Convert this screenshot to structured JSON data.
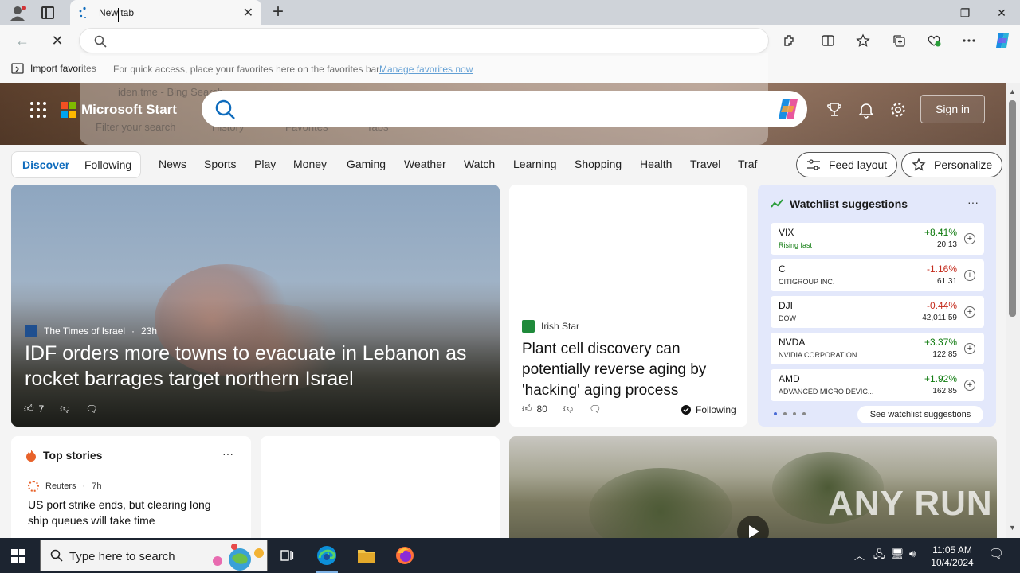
{
  "browser": {
    "tab_title": "New tab",
    "address_value": "",
    "suggestions": {
      "item1": "iden.tme",
      "item1_suffix": "- Bing Search",
      "filter_placeholder": "Filter your search",
      "filter_history": "History",
      "filter_favorites": "Favorites",
      "filter_tabs": "Tabs"
    }
  },
  "favbar": {
    "import_label": "Import favorites",
    "message": "For quick access, place your favorites here on the favorites bar.",
    "manage_link": "Manage favorites now"
  },
  "msstart": {
    "brand": "Microsoft Start",
    "signin": "Sign in",
    "pills": [
      "Discover",
      "Following"
    ],
    "categories": [
      "News",
      "Sports",
      "Play",
      "Money",
      "Gaming",
      "Weather",
      "Watch",
      "Learning",
      "Shopping",
      "Health",
      "Travel",
      "Traf"
    ],
    "feed_layout": "Feed layout",
    "personalize": "Personalize"
  },
  "main_story": {
    "source": "The Times of Israel",
    "age": "23h",
    "title": "IDF orders more towns to evacuate in Lebanon as rocket barrages target northern Israel",
    "likes": "7"
  },
  "story2": {
    "source": "Irish Star",
    "title": "Plant cell discovery can potentially reverse aging by 'hacking' aging process",
    "likes": "80",
    "following": "Following"
  },
  "watchlist": {
    "title": "Watchlist suggestions",
    "more": "···",
    "stocks": [
      {
        "ticker": "VIX",
        "name": "Rising fast",
        "change": "+8.41%",
        "price": "20.13",
        "direction": "up"
      },
      {
        "ticker": "C",
        "name": "CITIGROUP INC.",
        "change": "-1.16%",
        "price": "61.31",
        "direction": "down"
      },
      {
        "ticker": "DJI",
        "name": "DOW",
        "change": "-0.44%",
        "price": "42,011.59",
        "direction": "down"
      },
      {
        "ticker": "NVDA",
        "name": "NVIDIA CORPORATION",
        "change": "+3.37%",
        "price": "122.85",
        "direction": "up"
      },
      {
        "ticker": "AMD",
        "name": "ADVANCED MICRO DEVIC...",
        "change": "+1.92%",
        "price": "162.85",
        "direction": "up"
      }
    ],
    "see_more": "See watchlist suggestions",
    "colors": {
      "up": "#0f7b0f",
      "down": "#c42b1c"
    }
  },
  "top_stories": {
    "title": "Top stories",
    "more": "···",
    "source": "Reuters",
    "age": "7h",
    "headline": "US port strike ends, but clearing long ship queues will take time"
  },
  "video": {
    "watermark": "ANY RUN"
  },
  "taskbar": {
    "search_placeholder": "Type here to search",
    "time": "11:05 AM",
    "date": "10/4/2024"
  }
}
